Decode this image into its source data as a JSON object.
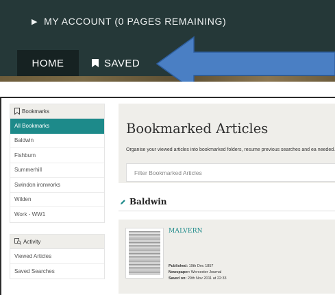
{
  "header": {
    "account_label": "MY ACCOUNT (0 PAGES REMAINING)",
    "home_label": "HOME",
    "saved_label": "SAVED"
  },
  "sidebar": {
    "bookmarks_heading": "Bookmarks",
    "items": [
      "All Bookmarks",
      "Baldwin",
      "Fishburn",
      "Summerhill",
      "Swindon ironworks",
      "Wilden",
      "Work - WW1"
    ],
    "active_index": 0,
    "activity_heading": "Activity",
    "activity_items": [
      "Viewed Articles",
      "Saved Searches"
    ]
  },
  "main": {
    "title": "Bookmarked Articles",
    "description": "Organise your viewed articles into bookmarked folders, resume previous searches and ea needed.",
    "filter_placeholder": "Filter Bookmarked Articles",
    "folder_title": "Baldwin",
    "article": {
      "title": "MALVERN",
      "published_label": "Published:",
      "published_value": "19th Dec 1857",
      "newspaper_label": "Newspaper:",
      "newspaper_value": "Worcester Journal",
      "saved_label": "Saved on:",
      "saved_value": "29th Nov 2011 at 22:33"
    }
  },
  "colors": {
    "header_bg": "#253838",
    "accent": "#1d8a8a",
    "arrow": "#4a7fc4"
  }
}
